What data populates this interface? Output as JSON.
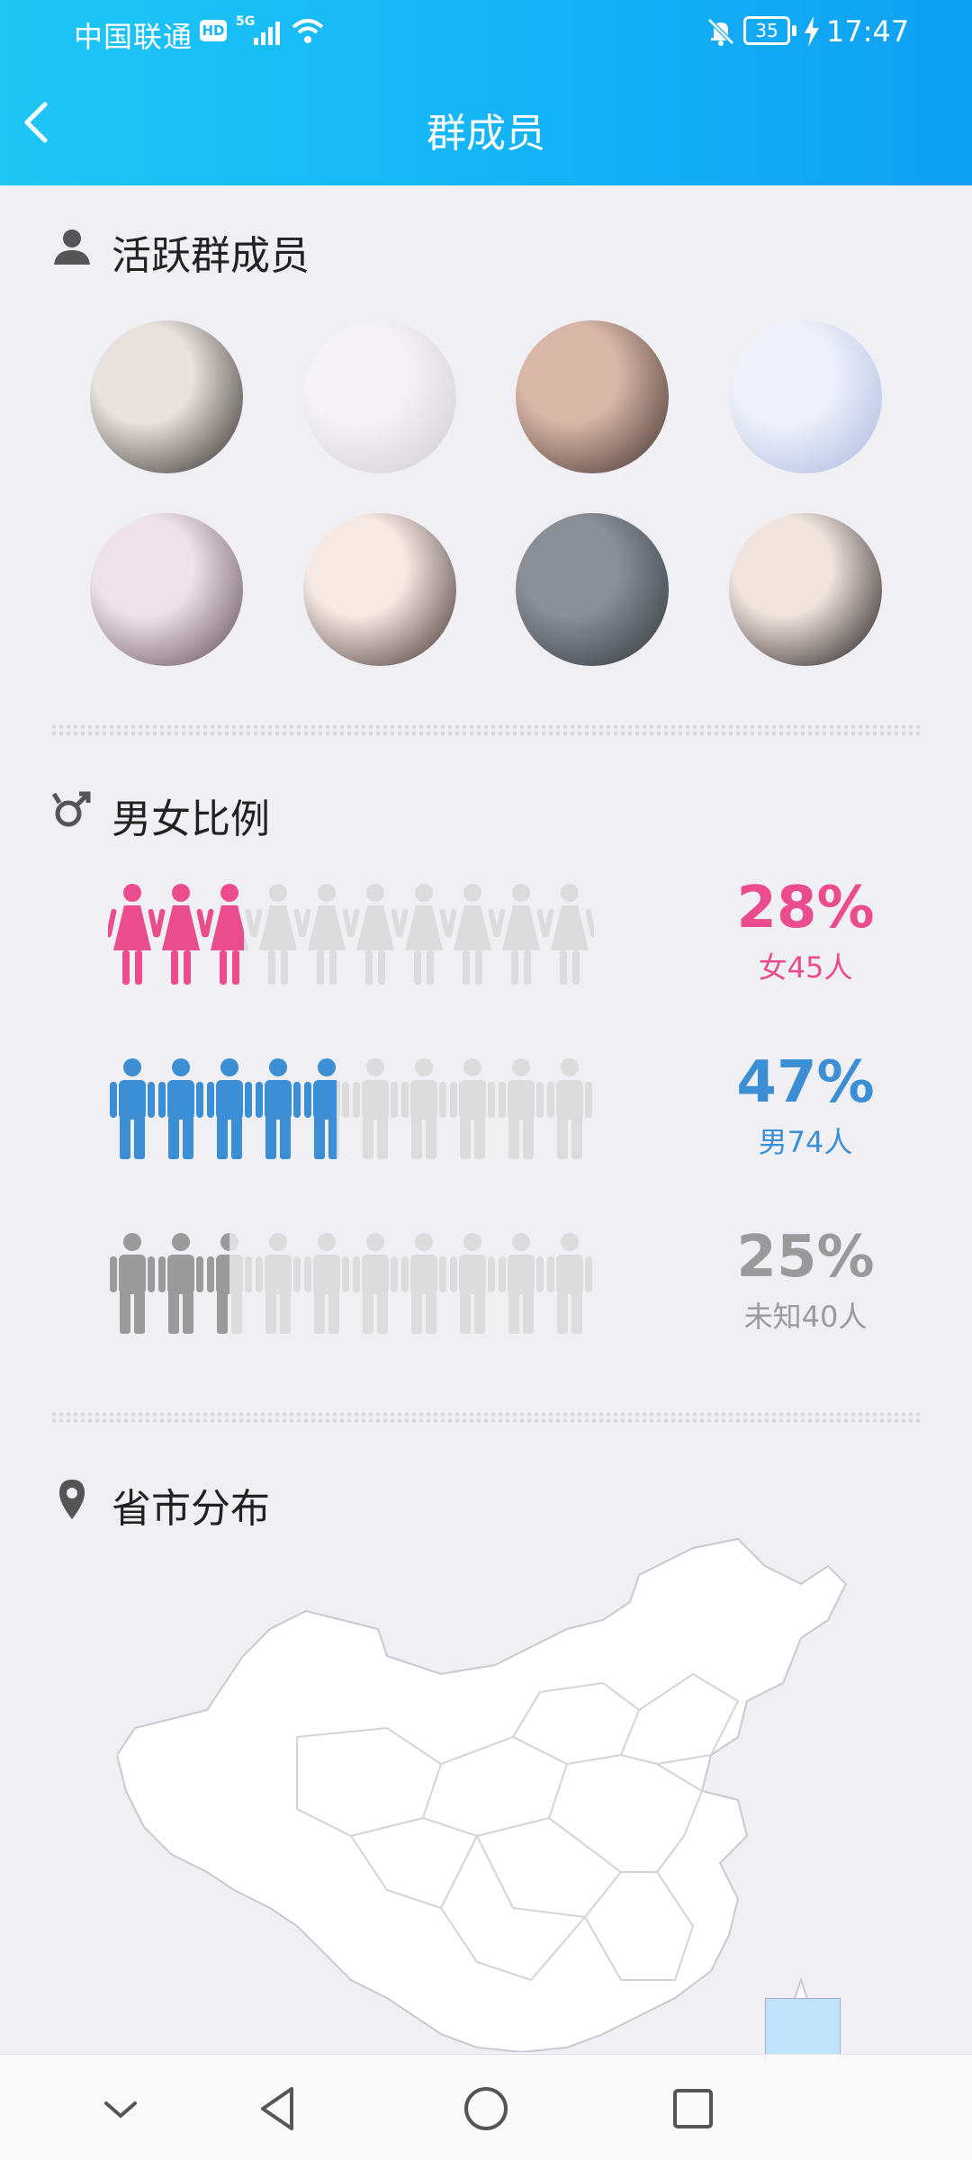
{
  "status_bar": {
    "carrier": "中国联通",
    "hd": "HD",
    "network": "5G",
    "battery": "35",
    "time": "17:47"
  },
  "header": {
    "title": "群成员"
  },
  "active_members": {
    "title": "活跃群成员",
    "avatars": [
      {
        "name": "member-avatar-1",
        "color1": "#e8e3df",
        "color2": "#2b2622"
      },
      {
        "name": "member-avatar-2",
        "color1": "#f5f3f5",
        "color2": "#cfcbd2"
      },
      {
        "name": "member-avatar-3",
        "color1": "#d9b7a8",
        "color2": "#3a2c2a"
      },
      {
        "name": "member-avatar-4",
        "color1": "#f0f2fb",
        "color2": "#a9b6df"
      },
      {
        "name": "member-avatar-5",
        "color1": "#efe3ea",
        "color2": "#5b4650"
      },
      {
        "name": "member-avatar-6",
        "color1": "#f6e9e4",
        "color2": "#3b2b2a"
      },
      {
        "name": "member-avatar-7",
        "color1": "#8a8f98",
        "color2": "#2f3238"
      },
      {
        "name": "member-avatar-8",
        "color1": "#f1e4df",
        "color2": "#161313"
      }
    ]
  },
  "gender_ratio": {
    "title": "男女比例",
    "rows": [
      {
        "key": "female",
        "percent": "28%",
        "label": "女45人",
        "fill": 0.28,
        "color": "#ea4c8d"
      },
      {
        "key": "male",
        "percent": "47%",
        "label": "男74人",
        "fill": 0.47,
        "color": "#3c8fd5"
      },
      {
        "key": "unknown",
        "percent": "25%",
        "label": "未知40人",
        "fill": 0.25,
        "color": "#9a9a9a"
      }
    ],
    "inactive_color": "#dcdcdc"
  },
  "region": {
    "title": "省市分布"
  },
  "nav": {
    "icons": [
      "chevron-down-icon",
      "back-triangle-icon",
      "home-circle-icon",
      "recents-square-icon"
    ]
  }
}
